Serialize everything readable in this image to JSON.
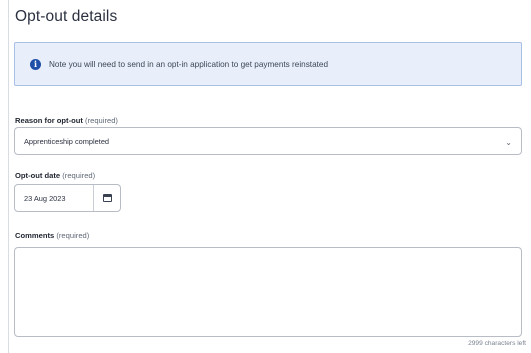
{
  "page": {
    "title": "Opt-out details"
  },
  "info_banner": {
    "icon": "info-icon",
    "text": "Note you will need to send in an opt-in application to get payments reinstated"
  },
  "reason": {
    "label": "Reason for opt-out",
    "required": "(required)",
    "selected": "Apprenticeship completed",
    "chevron": "⌄"
  },
  "date": {
    "label": "Opt-out date",
    "required": "(required)",
    "value": "23 Aug 2023",
    "icon": "calendar-icon"
  },
  "comments": {
    "label": "Comments",
    "required": "(required)",
    "value": "",
    "chars_left": "2999 characters left"
  },
  "colors": {
    "banner_bg": "#e8effb",
    "banner_border": "#a9c0e6",
    "info_icon": "#1f4fa8"
  }
}
